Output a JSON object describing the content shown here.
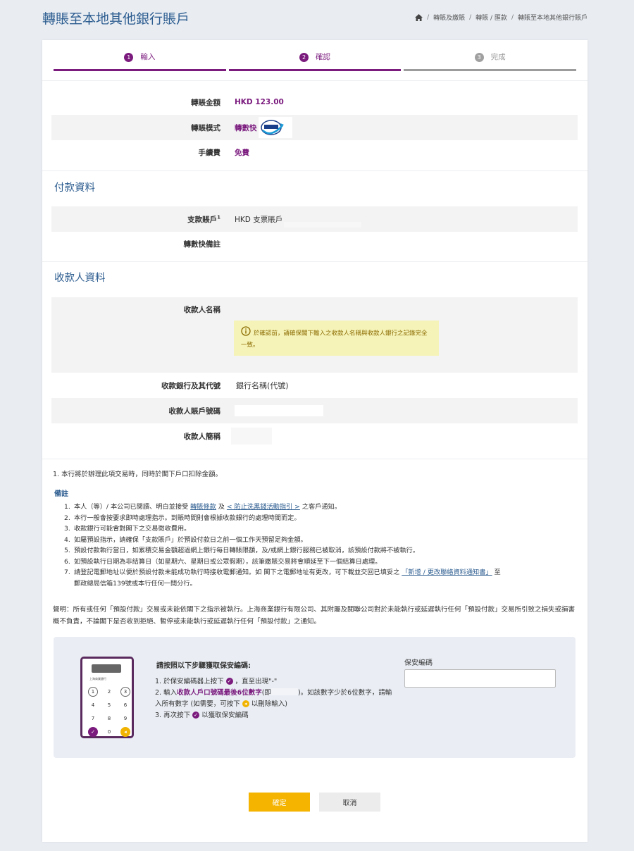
{
  "header": {
    "title": "轉賬至本地其他銀行賬戶",
    "breadcrumb": [
      "轉賬及繳賬",
      "轉賬 / 匯款",
      "轉賬至本地其他銀行賬戶"
    ]
  },
  "steps": [
    {
      "num": "1",
      "label": "輸入"
    },
    {
      "num": "2",
      "label": "確認"
    },
    {
      "num": "3",
      "label": "完成"
    }
  ],
  "summary": {
    "amount_label": "轉賬金額",
    "amount_value": "HKD 123.00",
    "mode_label": "轉賬模式",
    "mode_value": "轉數快",
    "fee_label": "手續費",
    "fee_value": "免費"
  },
  "payment": {
    "section_title": "付款資料",
    "account_label": "支款賬戶",
    "account_sup": "1",
    "account_value": "HKD 支票賬戶",
    "fps_note_label": "轉數快備註"
  },
  "payee": {
    "section_title": "收款人資料",
    "name_label": "收款人名稱",
    "warning": "於確認前，請確保閣下輸入之收款人名稱與收款人銀行之記錄完全一致。",
    "bank_label": "收款銀行及其代號",
    "bank_value": "銀行名稱(代號)",
    "account_label": "收款人賬戶號碼",
    "short_name_label": "收款人簡稱"
  },
  "note1": "1. 本行將於辦理此項交易時，同時於閣下戶口扣除金額。",
  "remarks": {
    "title": "備註",
    "r1_a": "本人（等）/ 本公司已閱讀、明白並接受",
    "r1_link1": "轉賬條款",
    "r1_b": "及",
    "r1_link2": "< 防止洗黑錢活動指引 >",
    "r1_c": "之客戶通知。",
    "r2": "本行一般會按要求即時處理指示。到賬時間則會根據收款銀行的處理時間而定。",
    "r3": "收款銀行可能會對閣下之交易徵收費用。",
    "r4": "如屬預設指示，請確保「支款賬戶」於預設付款日之前一個工作天預留足夠金額。",
    "r5": "預設付款執行當日，如累積交易金額超過網上銀行每日轉賬限額，及/或網上銀行服務已被取消，該預設付款將不被執行。",
    "r6": "如預設執行日期為非結算日（如星期六、星期日或公眾假期），該筆繳賬交易將會順延至下一個結算日處理。",
    "r7_a": "請登記電郵地址以便於預設付款未能成功執行時接收電郵通知。如 閣下之電郵地址有更改，可下載並交回已填妥之",
    "r7_link": "「新增 / 更改聯絡資料通知書」",
    "r7_b": "至",
    "r7_c": "郵政總局信箱139號或本行任何一間分行。"
  },
  "disclaimer": "聲明：所有或任何「預設付款」交易或未能依閣下之指示被執行。上海商業銀行有限公司、其附屬及關聯公司對於未能執行或延遲執行任何「預設付款」交易所引致之損失或損害概不負責，不論閣下是否收到拒絕、暫停或未能執行或延遲執行任何「預設付款」之通知。",
  "token": {
    "title": "請按照以下步驟獲取保安編碼:",
    "s1_a": "1. 於保安編碼器上按下",
    "s1_b": "，直至出現\"-\"",
    "s2_a": "2. 輸入",
    "s2_highlight": "收款人戶口號碼最後6位數字",
    "s2_b": "(即",
    "s2_c": ")。如該數字少於6位數字，請輸入所有數字 (如需要，可按下",
    "s2_d": "以刪除輸入)",
    "s3_a": "3. 再次按下",
    "s3_b": "以獲取保安編碼",
    "bank_name": "上海商業銀行",
    "input_label": "保安編碼",
    "keys": [
      "1",
      "2",
      "3",
      "4",
      "5",
      "6",
      "7",
      "8",
      "9",
      "✓",
      "0",
      "◂"
    ]
  },
  "buttons": {
    "confirm": "確定",
    "cancel": "取消"
  }
}
